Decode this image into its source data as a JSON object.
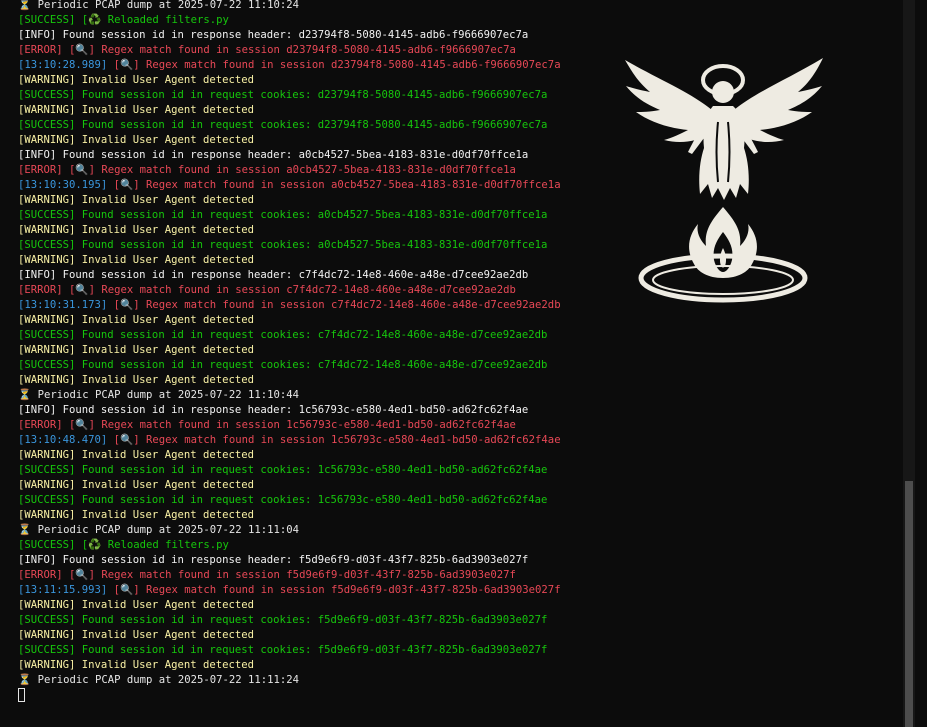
{
  "terminal": {
    "lines": [
      {
        "type": "plain",
        "text": "⏳ Periodic PCAP dump at 2025-07-22 11:10:24"
      },
      {
        "type": "success",
        "text": "[SUCCESS] [♻️ Reloaded filters.py"
      },
      {
        "type": "info",
        "text": "[INFO] Found session id in response header: d23794f8-5080-4145-adb6-f9666907ec7a"
      },
      {
        "type": "error",
        "text": "[ERROR] [🔍] Regex match found in session d23794f8-5080-4145-adb6-f9666907ec7a"
      },
      {
        "type": "ts",
        "ts": "[13:10:28.989]",
        "text": " [🔍] Regex match found in session d23794f8-5080-4145-adb6-f9666907ec7a"
      },
      {
        "type": "warning",
        "text": "[WARNING] Invalid User Agent detected"
      },
      {
        "type": "success",
        "text": "[SUCCESS] Found session id in request cookies: d23794f8-5080-4145-adb6-f9666907ec7a"
      },
      {
        "type": "warning",
        "text": "[WARNING] Invalid User Agent detected"
      },
      {
        "type": "success",
        "text": "[SUCCESS] Found session id in request cookies: d23794f8-5080-4145-adb6-f9666907ec7a"
      },
      {
        "type": "warning",
        "text": "[WARNING] Invalid User Agent detected"
      },
      {
        "type": "info",
        "text": "[INFO] Found session id in response header: a0cb4527-5bea-4183-831e-d0df70ffce1a"
      },
      {
        "type": "error",
        "text": "[ERROR] [🔍] Regex match found in session a0cb4527-5bea-4183-831e-d0df70ffce1a"
      },
      {
        "type": "ts",
        "ts": "[13:10:30.195]",
        "text": " [🔍] Regex match found in session a0cb4527-5bea-4183-831e-d0df70ffce1a"
      },
      {
        "type": "warning",
        "text": "[WARNING] Invalid User Agent detected"
      },
      {
        "type": "success",
        "text": "[SUCCESS] Found session id in request cookies: a0cb4527-5bea-4183-831e-d0df70ffce1a"
      },
      {
        "type": "warning",
        "text": "[WARNING] Invalid User Agent detected"
      },
      {
        "type": "success",
        "text": "[SUCCESS] Found session id in request cookies: a0cb4527-5bea-4183-831e-d0df70ffce1a"
      },
      {
        "type": "warning",
        "text": "[WARNING] Invalid User Agent detected"
      },
      {
        "type": "info",
        "text": "[INFO] Found session id in response header: c7f4dc72-14e8-460e-a48e-d7cee92ae2db"
      },
      {
        "type": "error",
        "text": "[ERROR] [🔍] Regex match found in session c7f4dc72-14e8-460e-a48e-d7cee92ae2db"
      },
      {
        "type": "ts",
        "ts": "[13:10:31.173]",
        "text": " [🔍] Regex match found in session c7f4dc72-14e8-460e-a48e-d7cee92ae2db"
      },
      {
        "type": "warning",
        "text": "[WARNING] Invalid User Agent detected"
      },
      {
        "type": "success",
        "text": "[SUCCESS] Found session id in request cookies: c7f4dc72-14e8-460e-a48e-d7cee92ae2db"
      },
      {
        "type": "warning",
        "text": "[WARNING] Invalid User Agent detected"
      },
      {
        "type": "success",
        "text": "[SUCCESS] Found session id in request cookies: c7f4dc72-14e8-460e-a48e-d7cee92ae2db"
      },
      {
        "type": "warning",
        "text": "[WARNING] Invalid User Agent detected"
      },
      {
        "type": "plain",
        "text": "⏳ Periodic PCAP dump at 2025-07-22 11:10:44"
      },
      {
        "type": "info",
        "text": "[INFO] Found session id in response header: 1c56793c-e580-4ed1-bd50-ad62fc62f4ae"
      },
      {
        "type": "error",
        "text": "[ERROR] [🔍] Regex match found in session 1c56793c-e580-4ed1-bd50-ad62fc62f4ae"
      },
      {
        "type": "ts",
        "ts": "[13:10:48.470]",
        "text": " [🔍] Regex match found in session 1c56793c-e580-4ed1-bd50-ad62fc62f4ae"
      },
      {
        "type": "warning",
        "text": "[WARNING] Invalid User Agent detected"
      },
      {
        "type": "success",
        "text": "[SUCCESS] Found session id in request cookies: 1c56793c-e580-4ed1-bd50-ad62fc62f4ae"
      },
      {
        "type": "warning",
        "text": "[WARNING] Invalid User Agent detected"
      },
      {
        "type": "success",
        "text": "[SUCCESS] Found session id in request cookies: 1c56793c-e580-4ed1-bd50-ad62fc62f4ae"
      },
      {
        "type": "warning",
        "text": "[WARNING] Invalid User Agent detected"
      },
      {
        "type": "plain",
        "text": "⏳ Periodic PCAP dump at 2025-07-22 11:11:04"
      },
      {
        "type": "success",
        "text": "[SUCCESS] [♻️ Reloaded filters.py"
      },
      {
        "type": "info",
        "text": "[INFO] Found session id in response header: f5d9e6f9-d03f-43f7-825b-6ad3903e027f"
      },
      {
        "type": "error",
        "text": "[ERROR] [🔍] Regex match found in session f5d9e6f9-d03f-43f7-825b-6ad3903e027f"
      },
      {
        "type": "ts",
        "ts": "[13:11:15.993]",
        "text": " [🔍] Regex match found in session f5d9e6f9-d03f-43f7-825b-6ad3903e027f"
      },
      {
        "type": "warning",
        "text": "[WARNING] Invalid User Agent detected"
      },
      {
        "type": "success",
        "text": "[SUCCESS] Found session id in request cookies: f5d9e6f9-d03f-43f7-825b-6ad3903e027f"
      },
      {
        "type": "warning",
        "text": "[WARNING] Invalid User Agent detected"
      },
      {
        "type": "success",
        "text": "[SUCCESS] Found session id in request cookies: f5d9e6f9-d03f-43f7-825b-6ad3903e027f"
      },
      {
        "type": "warning",
        "text": "[WARNING] Invalid User Agent detected"
      },
      {
        "type": "plain",
        "text": "⏳ Periodic PCAP dump at 2025-07-22 11:11:24"
      }
    ]
  },
  "logo": {
    "icon": "angel-flame-icon",
    "color": "#eeebe2"
  },
  "colors": {
    "background": "#0c0c0c",
    "info": "#f2f2f2",
    "error": "#e74856",
    "timestamp": "#3a96dd",
    "warning": "#f9f1a5",
    "success": "#16c60c"
  }
}
